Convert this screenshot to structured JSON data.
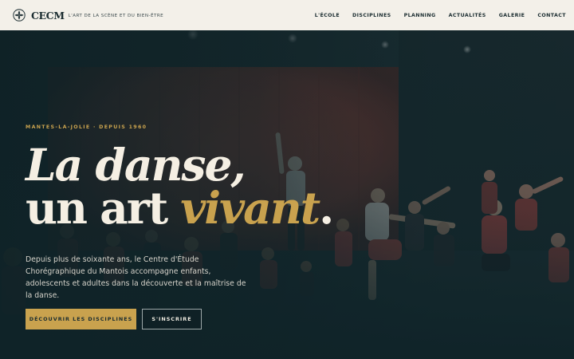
{
  "header": {
    "logo_icon": "fleur-emblem-icon",
    "brand_name": "CECM",
    "tagline": "L'ART DE LA SCÈNE ET DU BIEN-ÊTRE",
    "nav": [
      {
        "label": "L'ÉCOLE"
      },
      {
        "label": "DISCIPLINES"
      },
      {
        "label": "PLANNING"
      },
      {
        "label": "ACTUALITÉS"
      },
      {
        "label": "GALERIE"
      },
      {
        "label": "CONTACT"
      }
    ]
  },
  "hero": {
    "eyebrow": "MANTES-LA-JOLIE · DEPUIS 1960",
    "title_line1": "La danse,",
    "title_line2_prefix": "un art ",
    "title_line2_accent": "vivant",
    "title_line2_suffix": ".",
    "description": "Depuis plus de soixante ans, le Centre d'Étude Chorégraphique du Mantois accompagne enfants, adolescents et adultes dans la découverte et la maîtrise de la danse.",
    "primary_button": "DÉCOUVRIR LES DISCIPLINES",
    "secondary_button": "S'INSCRIRE"
  },
  "colors": {
    "header_bg": "#f3f0e9",
    "accent_gold": "#c9a24e",
    "dark_teal": "#14282d",
    "text_light": "#f5efe3"
  }
}
